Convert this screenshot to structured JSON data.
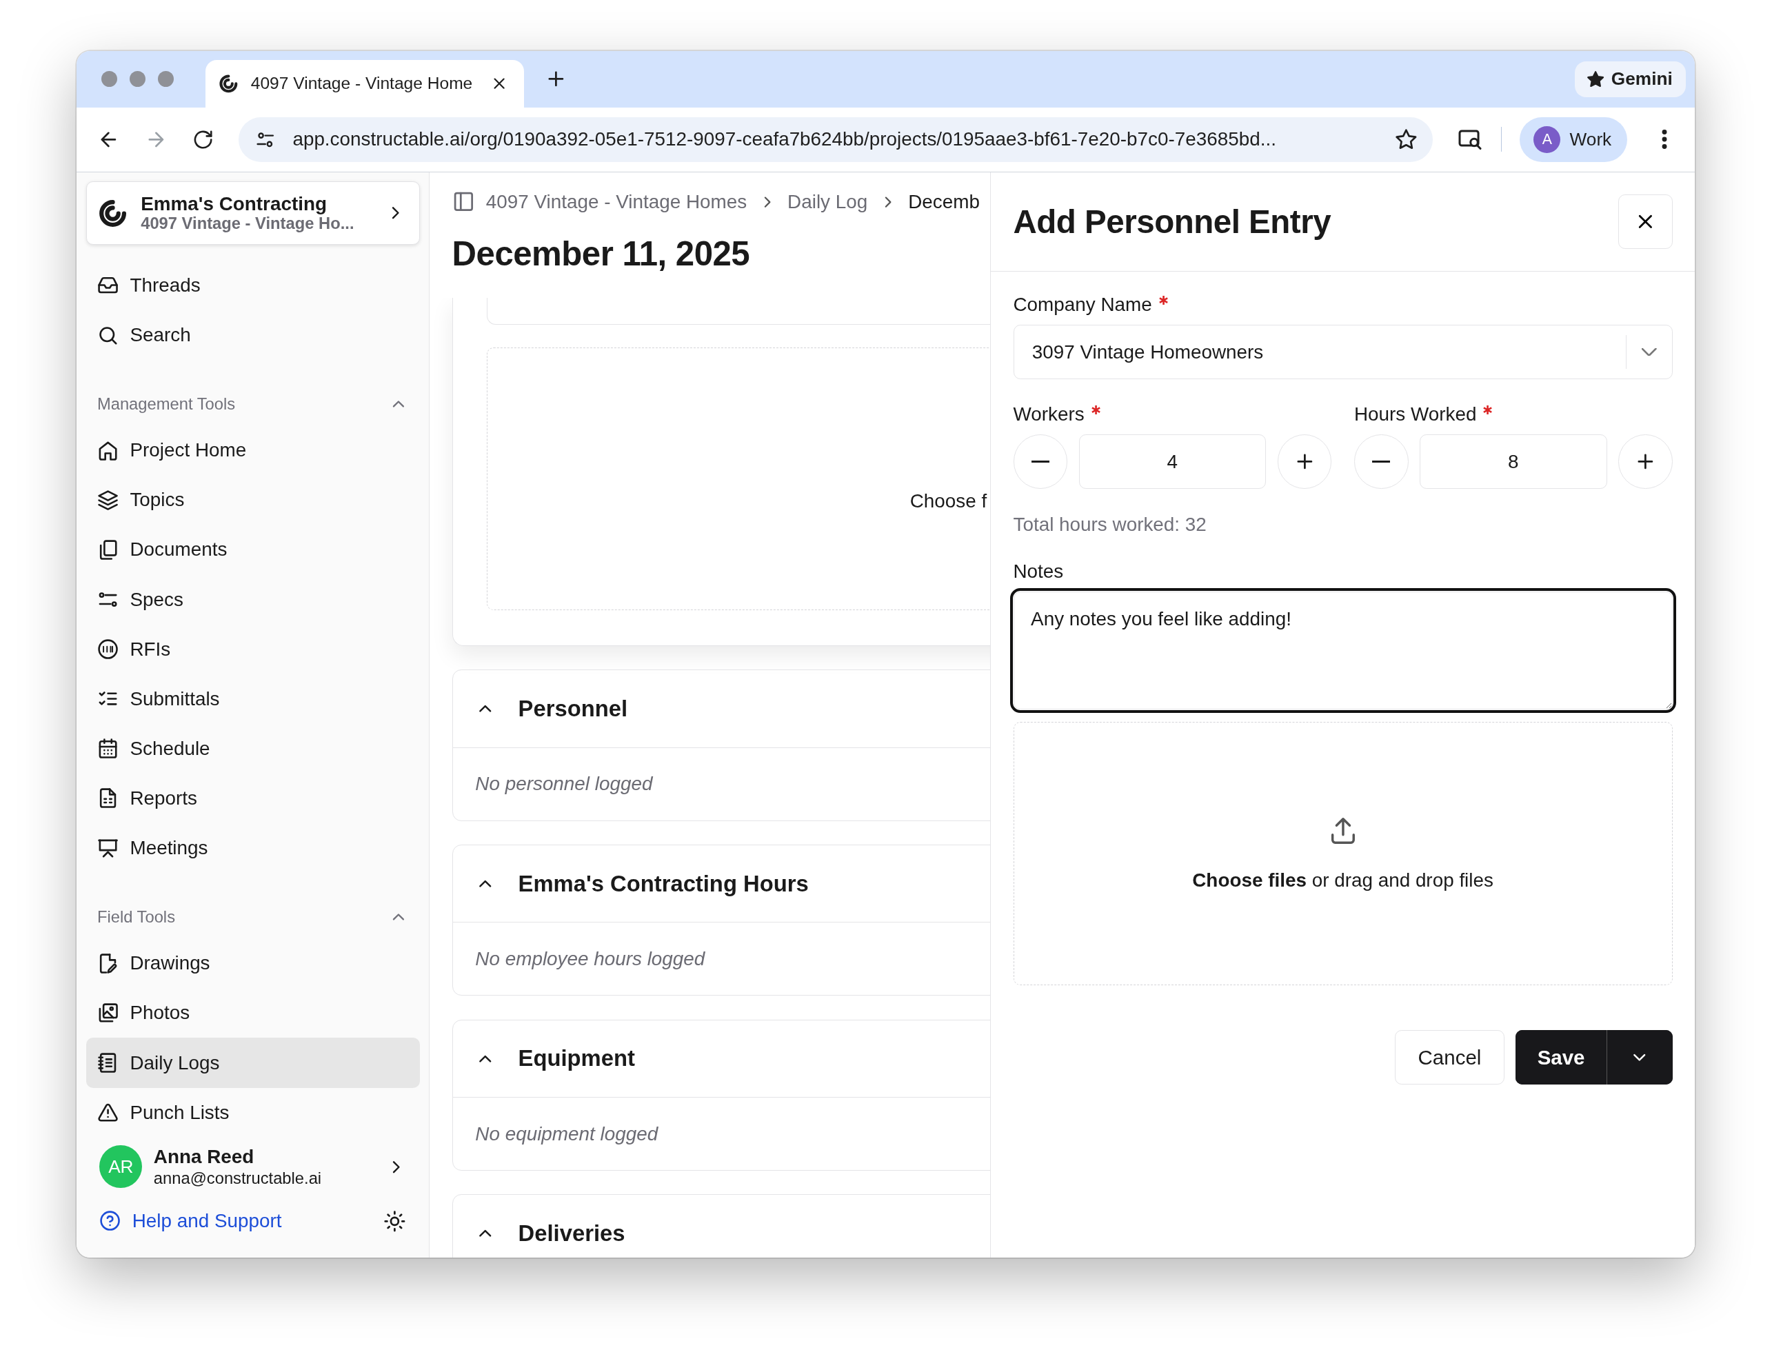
{
  "browser": {
    "tabs": [
      {
        "title": "4097 Vintage - Vintage Home",
        "selected": true
      }
    ],
    "gemini": "Gemini",
    "url": "app.constructable.ai/org/0190a392-05e1-7512-9097-ceafa7b624bb/projects/0195aae3-bf61-7e20-b7c0-7e3685bd...",
    "profile": {
      "initial": "A",
      "label": "Work"
    }
  },
  "sidebar": {
    "org": {
      "name": "Emma's Contracting",
      "project": "4097 Vintage - Vintage Ho..."
    },
    "top_items": [
      {
        "label": "Threads",
        "selected": false
      },
      {
        "label": "Search",
        "selected": false
      }
    ],
    "sections": [
      {
        "title": "Management Tools",
        "expanded": true,
        "items": [
          {
            "label": "Project Home",
            "selected": false
          },
          {
            "label": "Topics",
            "selected": false
          },
          {
            "label": "Documents",
            "selected": false
          },
          {
            "label": "Specs",
            "selected": false
          },
          {
            "label": "RFIs",
            "selected": false
          },
          {
            "label": "Submittals",
            "selected": false
          },
          {
            "label": "Schedule",
            "selected": false
          },
          {
            "label": "Reports",
            "selected": false
          },
          {
            "label": "Meetings",
            "selected": false
          }
        ]
      },
      {
        "title": "Field Tools",
        "expanded": true,
        "items": [
          {
            "label": "Drawings",
            "selected": false
          },
          {
            "label": "Photos",
            "selected": false
          },
          {
            "label": "Daily Logs",
            "selected": true
          },
          {
            "label": "Punch Lists",
            "selected": false
          }
        ]
      }
    ],
    "user": {
      "initials": "AR",
      "name": "Anna Reed",
      "email": "anna@constructable.ai"
    },
    "help": "Help and Support"
  },
  "main": {
    "breadcrumb": [
      "4097 Vintage - Vintage Homes",
      "Daily Log",
      "Decemb"
    ],
    "title": "December 11, 2025",
    "upload_hint": "Choose f",
    "sections": [
      {
        "title": "Personnel",
        "expanded": true,
        "empty_text": "No personnel logged"
      },
      {
        "title": "Emma's Contracting Hours",
        "expanded": true,
        "empty_text": "No employee hours logged"
      },
      {
        "title": "Equipment",
        "expanded": true,
        "empty_text": "No equipment logged"
      },
      {
        "title": "Deliveries",
        "expanded": true
      }
    ]
  },
  "drawer": {
    "title": "Add Personnel Entry",
    "company": {
      "label": "Company Name",
      "required": true,
      "value": "3097 Vintage Homeowners"
    },
    "steppers": [
      {
        "label": "Workers",
        "required": true,
        "value": "4"
      },
      {
        "label": "Hours Worked",
        "required": true,
        "value": "8"
      }
    ],
    "total": "Total hours worked: 32",
    "notes": {
      "label": "Notes",
      "value": "Any notes you feel like adding!",
      "focused": true
    },
    "dropzone": "**Choose files** or drag and drop files",
    "buttons": {
      "cancel": "Cancel",
      "save": "Save"
    }
  }
}
